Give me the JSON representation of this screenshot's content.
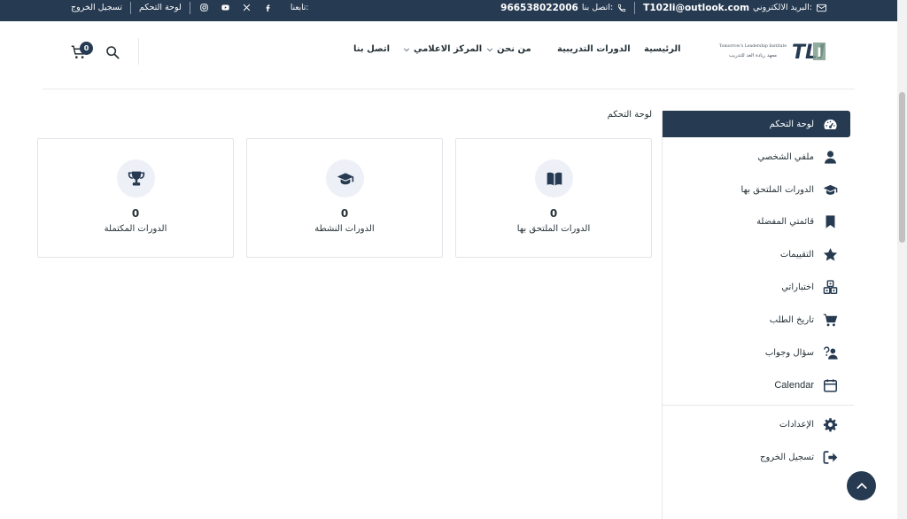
{
  "colors": {
    "primary": "#263a52",
    "icon_bg": "#eef0f7",
    "border": "#e2e5e9"
  },
  "topbar": {
    "email_label": "البريد الالكتروني:",
    "email": "T102li@outlook.com",
    "phone_label": "اتصل بنا:",
    "phone": "966538022006",
    "follow_label": "تابعنا:",
    "dashboard_link": "لوحة التحكم",
    "logout_link": "تسجيل الخروج",
    "social_icons": [
      "facebook-icon",
      "x-icon",
      "youtube-icon",
      "instagram-icon"
    ]
  },
  "logo": {
    "line1": "Tomorrow's Leadership Institute",
    "line2": "معهد ريادة الغد للتدريب",
    "mark": "TLI"
  },
  "nav": {
    "home": "الرئيسية",
    "courses": "الدورات التدريبية",
    "about": "من نحن",
    "media": "المركز الاعلامي",
    "contact": "اتصل بنا"
  },
  "cart": {
    "count": "0"
  },
  "dashboard": {
    "title": "لوحة التحكم",
    "cards": [
      {
        "icon": "book-icon",
        "value": "0",
        "label": "الدورات الملتحق بها"
      },
      {
        "icon": "graduation-cap-icon",
        "value": "0",
        "label": "الدورات النشطة"
      },
      {
        "icon": "trophy-icon",
        "value": "0",
        "label": "الدورات المكتملة"
      }
    ]
  },
  "sidebar": {
    "items": [
      {
        "label": "لوحة التحكم",
        "icon": "gauge-icon",
        "active": true
      },
      {
        "label": "ملفي الشخصي",
        "icon": "user-icon"
      },
      {
        "label": "الدورات الملتحق بها",
        "icon": "graduation-cap-icon"
      },
      {
        "label": "قائمتي المفضلة",
        "icon": "bookmark-icon"
      },
      {
        "label": "التقييمات",
        "icon": "star-icon"
      },
      {
        "label": "اختباراتي",
        "icon": "quiz-blocks-icon"
      },
      {
        "label": "تاريخ الطلب",
        "icon": "cart-icon"
      },
      {
        "label": "سؤال وجواب",
        "icon": "question-user-icon"
      },
      {
        "label": "Calendar",
        "icon": "calendar-icon"
      },
      {
        "label": "الإعدادات",
        "icon": "gear-icon"
      },
      {
        "label": "تسجيل الخروج",
        "icon": "sign-out-icon"
      }
    ]
  }
}
